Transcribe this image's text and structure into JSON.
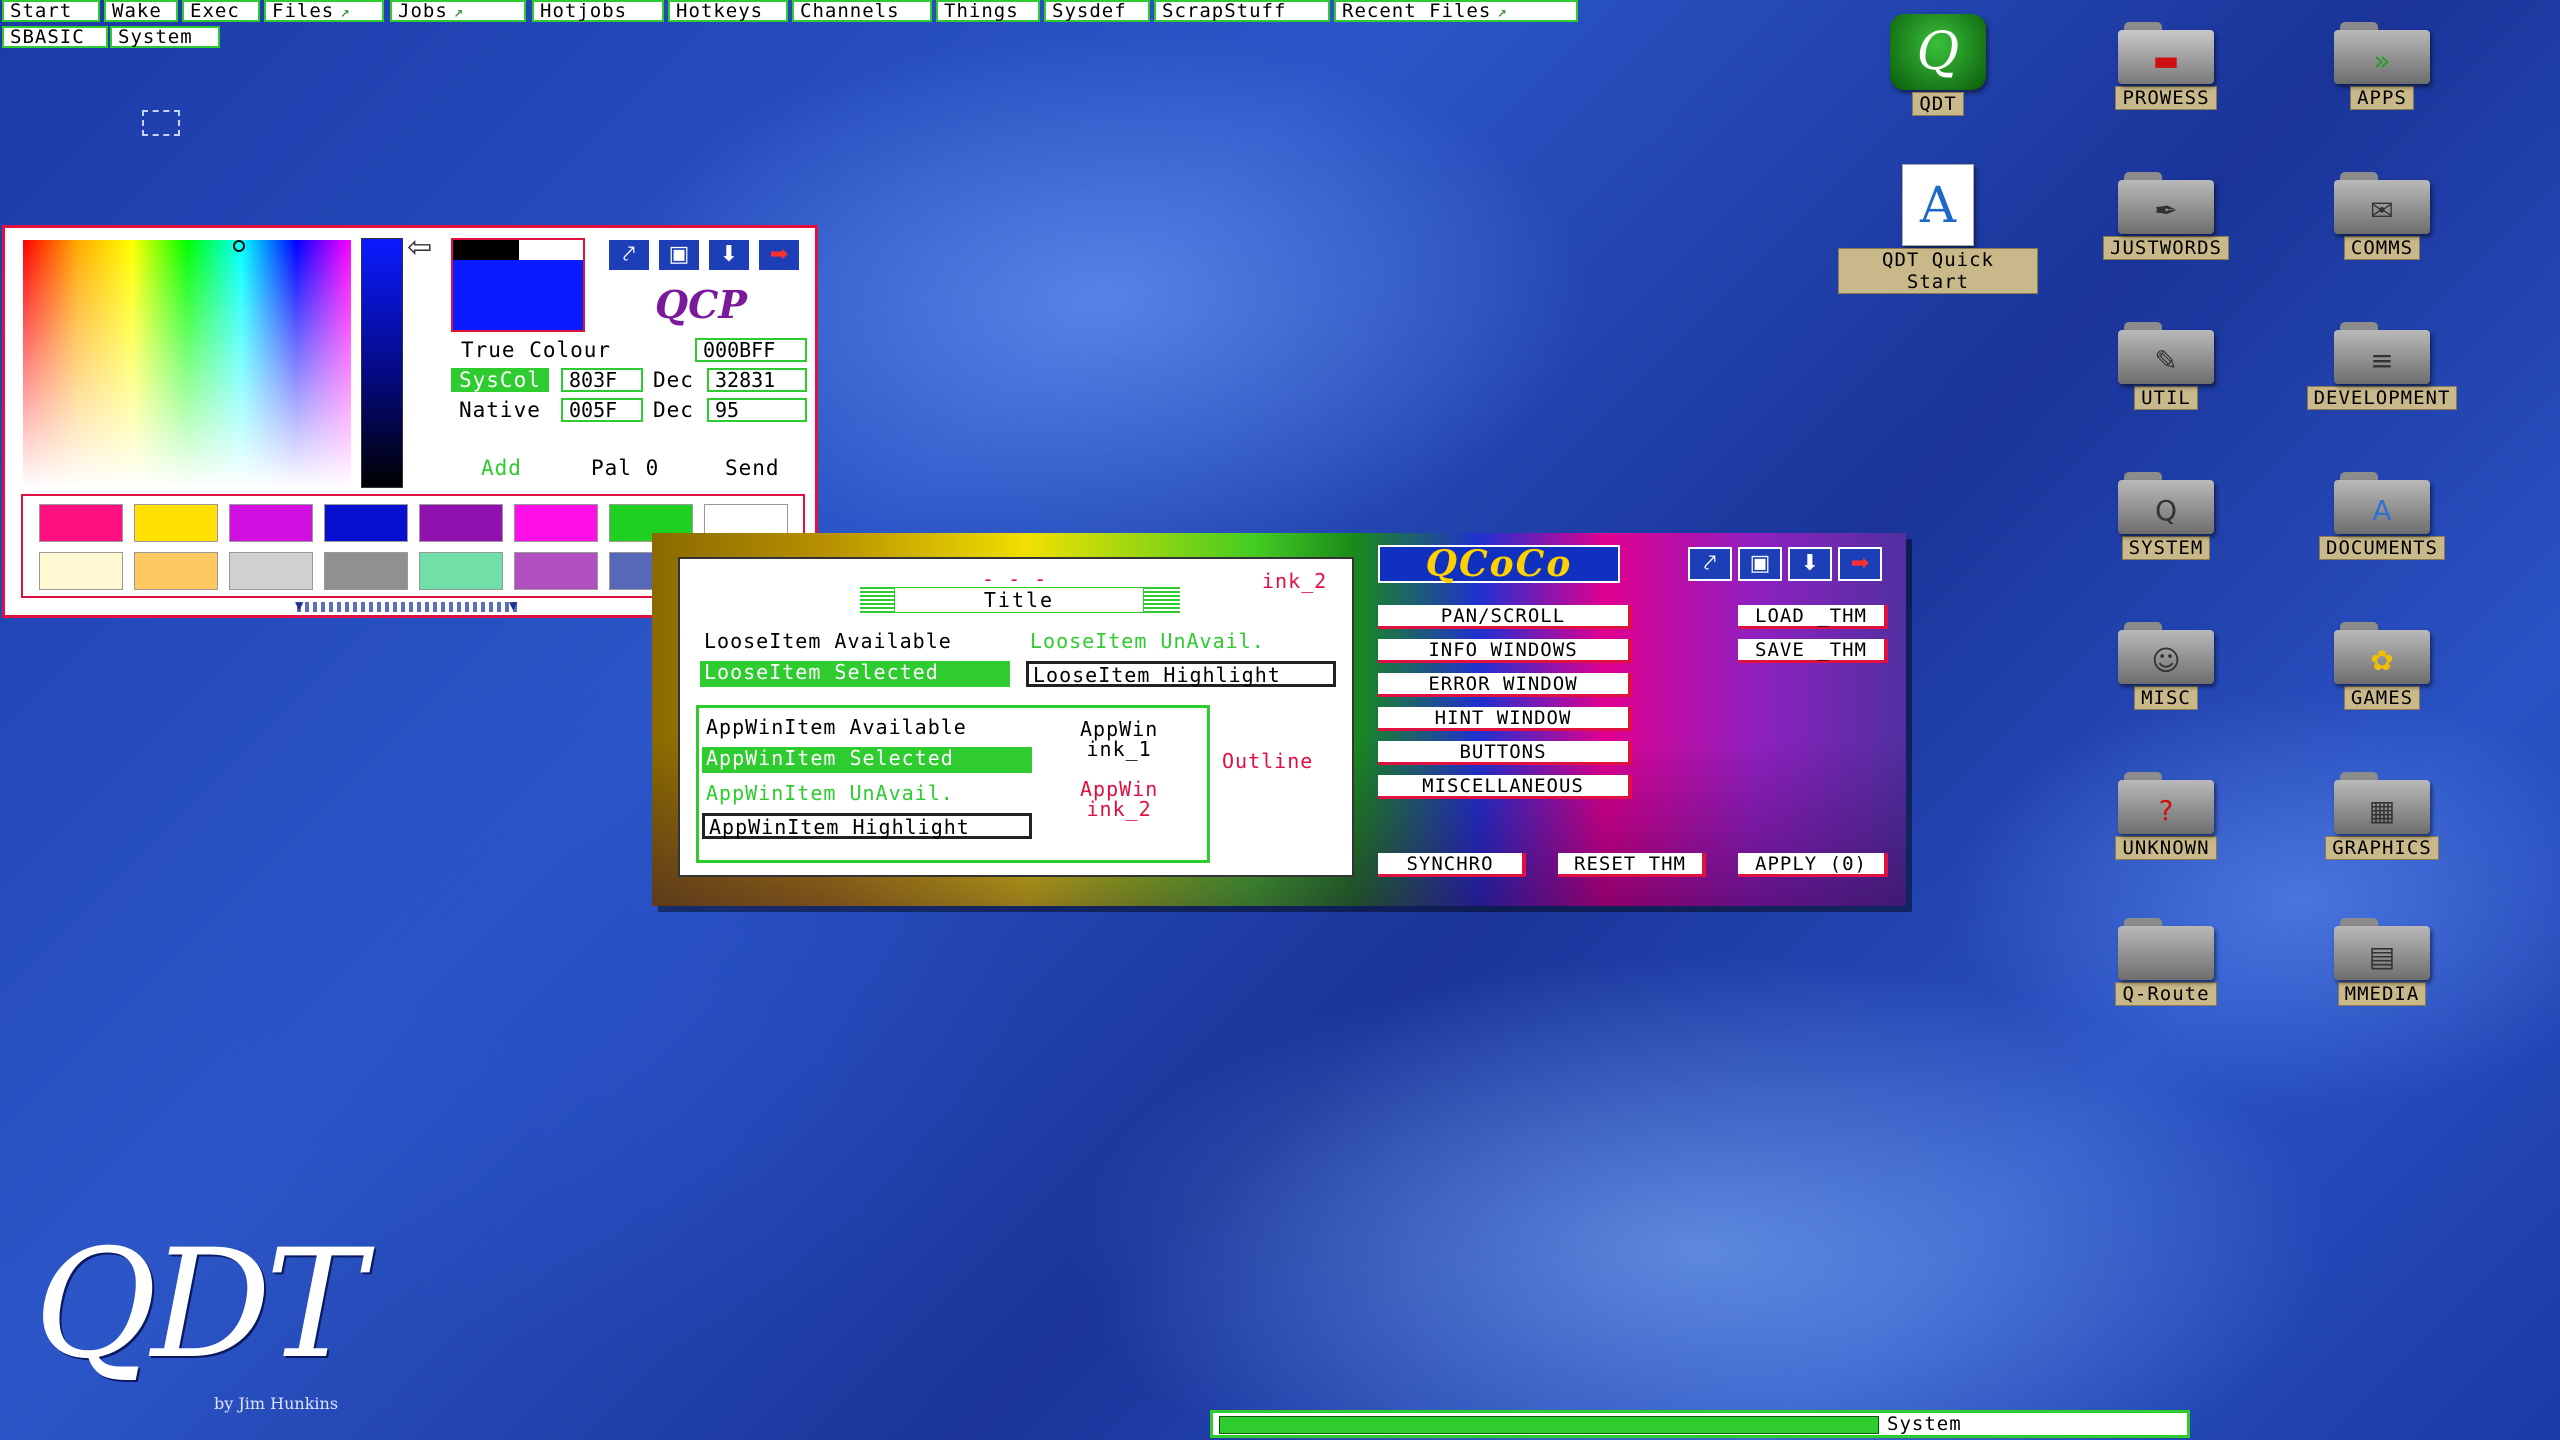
{
  "menu": {
    "row1": [
      {
        "label": "Start",
        "arrow": false
      },
      {
        "label": "Wake",
        "arrow": false
      },
      {
        "label": "Exec",
        "arrow": false
      },
      {
        "label": "Files",
        "arrow": true
      },
      {
        "label": "Jobs",
        "arrow": true
      },
      {
        "label": "Hotjobs",
        "arrow": false
      },
      {
        "label": "Hotkeys",
        "arrow": false
      },
      {
        "label": "Channels",
        "arrow": false
      },
      {
        "label": "Things",
        "arrow": false
      },
      {
        "label": "Sysdef",
        "arrow": false
      },
      {
        "label": "ScrapStuff",
        "arrow": false
      },
      {
        "label": "Recent Files",
        "arrow": true
      }
    ],
    "row2": [
      {
        "label": "SBASIC"
      },
      {
        "label": "System"
      }
    ]
  },
  "desktop_icons": [
    {
      "label": "QDT",
      "icon": "qdt-logo-icon"
    },
    {
      "label": "PROWESS",
      "icon": "folder-icon"
    },
    {
      "label": "APPS",
      "icon": "folder-icon"
    },
    {
      "label": "QDT Quick Start",
      "icon": "document-icon"
    },
    {
      "label": "JUSTWORDS",
      "icon": "folder-icon"
    },
    {
      "label": "COMMS",
      "icon": "folder-icon"
    },
    {
      "label": "UTIL",
      "icon": "folder-icon"
    },
    {
      "label": "DEVELOPMENT",
      "icon": "folder-icon"
    },
    {
      "label": "SYSTEM",
      "icon": "folder-icon"
    },
    {
      "label": "DOCUMENTS",
      "icon": "folder-icon"
    },
    {
      "label": "MISC",
      "icon": "folder-icon"
    },
    {
      "label": "GAMES",
      "icon": "folder-icon"
    },
    {
      "label": "UNKNOWN",
      "icon": "folder-icon"
    },
    {
      "label": "GRAPHICS",
      "icon": "folder-icon"
    },
    {
      "label": "Q-Route",
      "icon": "folder-icon"
    },
    {
      "label": "MMEDIA",
      "icon": "folder-icon"
    }
  ],
  "qcp": {
    "logo": "QCP",
    "true_colour_label": "True Colour",
    "true_colour_value": "000BFF",
    "syscol_label": "SysCol",
    "syscol_value": "803F",
    "dec_label": "Dec",
    "syscol_dec": "32831",
    "native_label": "Native",
    "native_value": "005F",
    "native_dec": "95",
    "add_label": "Add",
    "pal_label": "Pal 0",
    "send_label": "Send",
    "selected_color": "#0B1BFF",
    "swatches_row1": [
      "#FF1080",
      "#FFE000",
      "#D010E0",
      "#0A10D0",
      "#9010B0",
      "#FF10E8",
      "#20D020",
      "#FFFFFF"
    ],
    "swatches_row2": [
      "#FFF8D0",
      "#FFC860",
      "#D0D0D0",
      "#909090",
      "#70E0A8",
      "#B050C0",
      "#5868B8",
      "#509850"
    ]
  },
  "qcoco": {
    "logo": "QCoCo",
    "dashes": "- - -",
    "ink2": "ink_2",
    "title": "Title",
    "loose_available": "LooseItem Available",
    "loose_unavail": "LooseItem UnAvail.",
    "loose_selected": "LooseItem Selected",
    "loose_highlight": "LooseItem Highlight",
    "appwin_available": "AppWinItem Available",
    "appwin_selected": "AppWinItem Selected",
    "appwin_unavail": "AppWinItem UnAvail.",
    "appwin_highlight": "AppWinItem Highlight",
    "appwin_ink1": "AppWin\nink_1",
    "appwin_ink2": "AppWin\nink_2",
    "outline": "Outline",
    "buttons": [
      "PAN/SCROLL",
      "INFO WINDOWS",
      "ERROR WINDOW",
      "HINT WINDOW",
      "BUTTONS",
      "MISCELLANEOUS"
    ],
    "load_thm": "LOAD _THM",
    "save_thm": "SAVE _THM",
    "synchro": "SYNCHRO",
    "reset_thm": "RESET THM",
    "apply": "APPLY (0)"
  },
  "taskbar": {
    "label": "System"
  },
  "branding": {
    "logo": "QDT",
    "byline": "by Jim Hunkins"
  },
  "colors": {
    "accent_green": "#2ECC2E",
    "accent_red": "#E01040",
    "desktop_blue": "#1E3FAE"
  }
}
